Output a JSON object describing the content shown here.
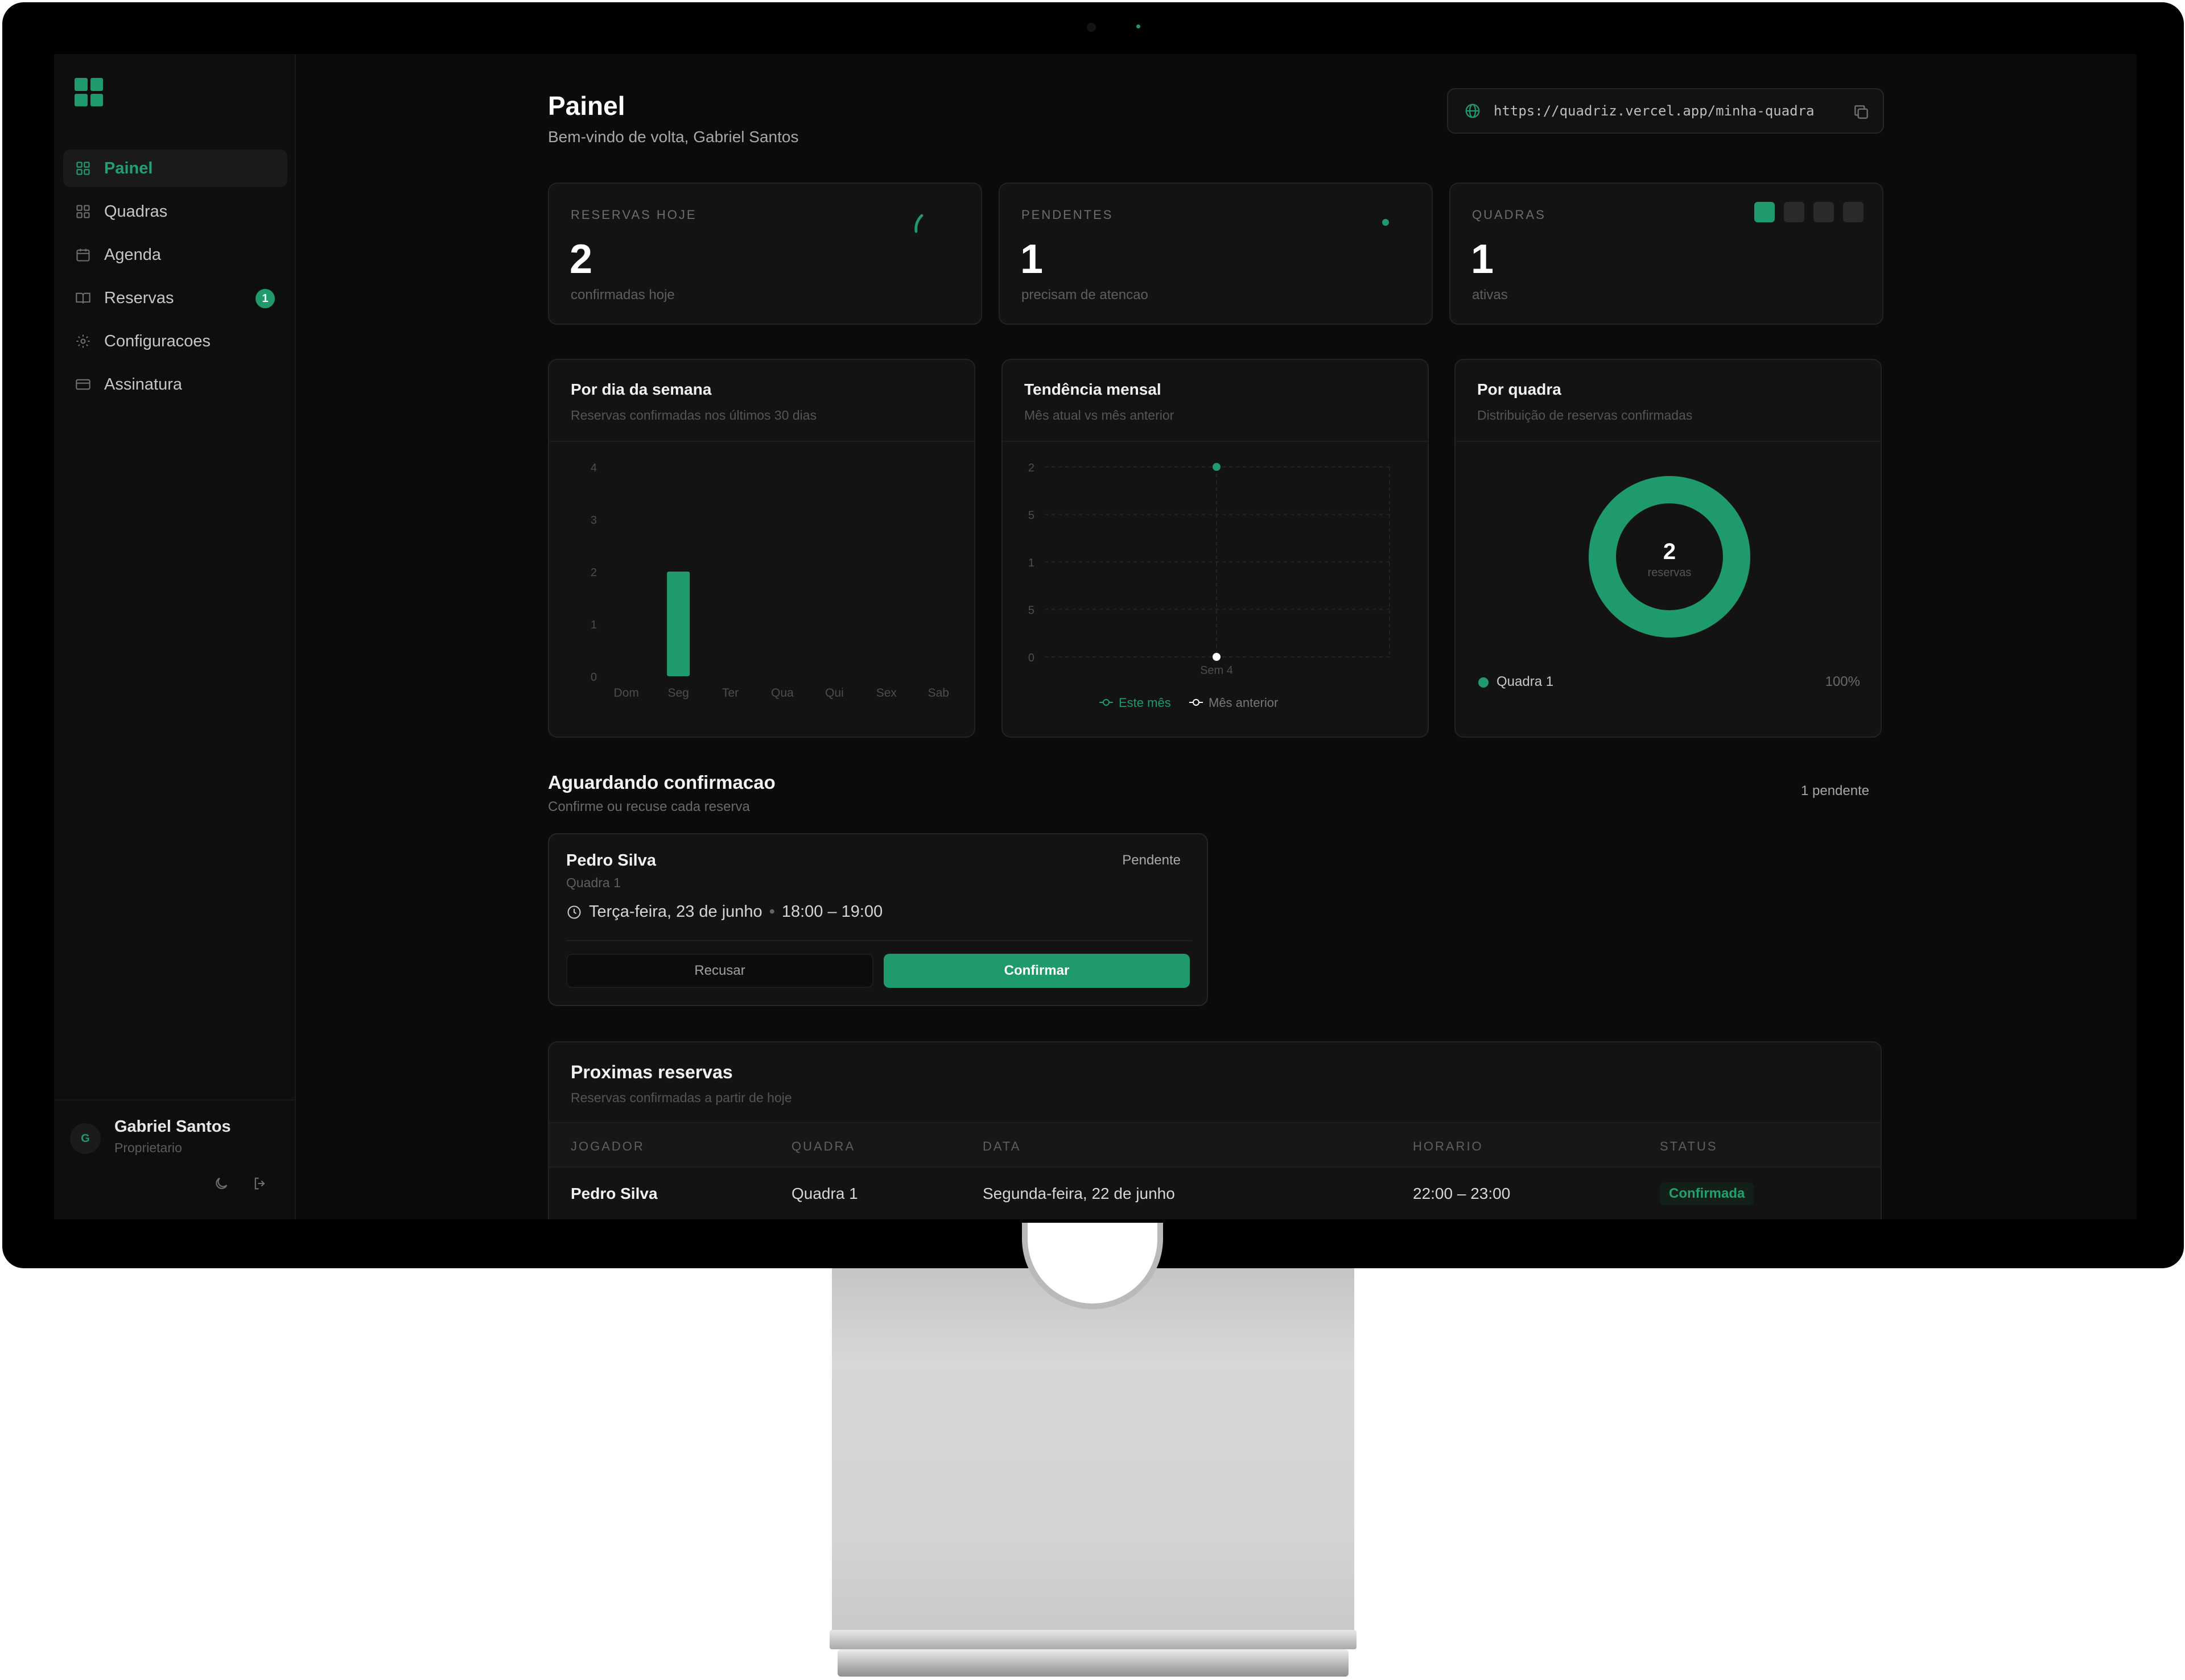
{
  "sidebar": {
    "items": [
      {
        "label": "Painel",
        "icon": "grid-icon",
        "active": true
      },
      {
        "label": "Quadras",
        "icon": "grid-icon",
        "active": false
      },
      {
        "label": "Agenda",
        "icon": "calendar-icon",
        "active": false
      },
      {
        "label": "Reservas",
        "icon": "book-icon",
        "active": false,
        "badge": "1"
      },
      {
        "label": "Configuracoes",
        "icon": "gear-icon",
        "active": false
      },
      {
        "label": "Assinatura",
        "icon": "card-icon",
        "active": false
      }
    ],
    "user": {
      "initial": "G",
      "name": "Gabriel Santos",
      "role": "Proprietario"
    }
  },
  "header": {
    "title": "Painel",
    "subtitle": "Bem-vindo de volta, Gabriel Santos",
    "url": "https://quadriz.vercel.app/minha-quadra"
  },
  "stats": [
    {
      "label": "RESERVAS HOJE",
      "value": "2",
      "note": "confirmadas hoje"
    },
    {
      "label": "PENDENTES",
      "value": "1",
      "note": "precisam de atencao"
    },
    {
      "label": "QUADRAS",
      "value": "1",
      "note": "ativas"
    }
  ],
  "charts": {
    "weekday": {
      "title": "Por dia da semana",
      "subtitle": "Reservas confirmadas nos últimos 30 dias"
    },
    "monthly": {
      "title": "Tendência mensal",
      "subtitle": "Mês atual vs mês anterior"
    },
    "court": {
      "title": "Por quadra",
      "subtitle": "Distribuição de reservas confirmadas"
    }
  },
  "chart_data": [
    {
      "type": "bar",
      "categories": [
        "Dom",
        "Seg",
        "Ter",
        "Qua",
        "Qui",
        "Sex",
        "Sab"
      ],
      "values": [
        0,
        2,
        0,
        0,
        0,
        0,
        0
      ],
      "yticks": [
        "4",
        "3",
        "2",
        "1",
        "0"
      ],
      "ylim": [
        0,
        4
      ],
      "color": "#1f9a6c"
    },
    {
      "type": "line",
      "x": [
        "Sem 4"
      ],
      "yticks": [
        "2",
        "5",
        "1",
        "5",
        "0"
      ],
      "ylim": [
        0,
        2
      ],
      "series": [
        {
          "name": "Este mês",
          "values": [
            2
          ],
          "color": "#1f9a6c"
        },
        {
          "name": "Mês anterior",
          "values": [
            0
          ],
          "color": "#ffffff"
        }
      ]
    },
    {
      "type": "pie",
      "center_value": "2",
      "center_label": "reservas",
      "slices": [
        {
          "name": "Quadra 1",
          "value": 2,
          "percent": "100%",
          "color": "#1f9a6c"
        }
      ]
    }
  ],
  "pending": {
    "title": "Aguardando confirmacao",
    "subtitle": "Confirme ou recuse cada reserva",
    "count_label": "1 pendente",
    "card": {
      "name": "Pedro Silva",
      "court": "Quadra 1",
      "status": "Pendente",
      "date": "Terça-feira, 23 de junho",
      "time": "18:00 – 19:00",
      "reject_label": "Recusar",
      "confirm_label": "Confirmar"
    }
  },
  "upcoming": {
    "title": "Proximas reservas",
    "subtitle": "Reservas confirmadas a partir de hoje",
    "columns": [
      "JOGADOR",
      "QUADRA",
      "DATA",
      "HORARIO",
      "STATUS"
    ],
    "rows": [
      {
        "player": "Pedro Silva",
        "court": "Quadra 1",
        "date": "Segunda-feira, 22 de junho",
        "time": "22:00 – 23:00",
        "status": "Confirmada"
      }
    ]
  },
  "colors": {
    "accent": "#1f9a6c",
    "background": "#0b0b0b",
    "card": "#131313"
  }
}
